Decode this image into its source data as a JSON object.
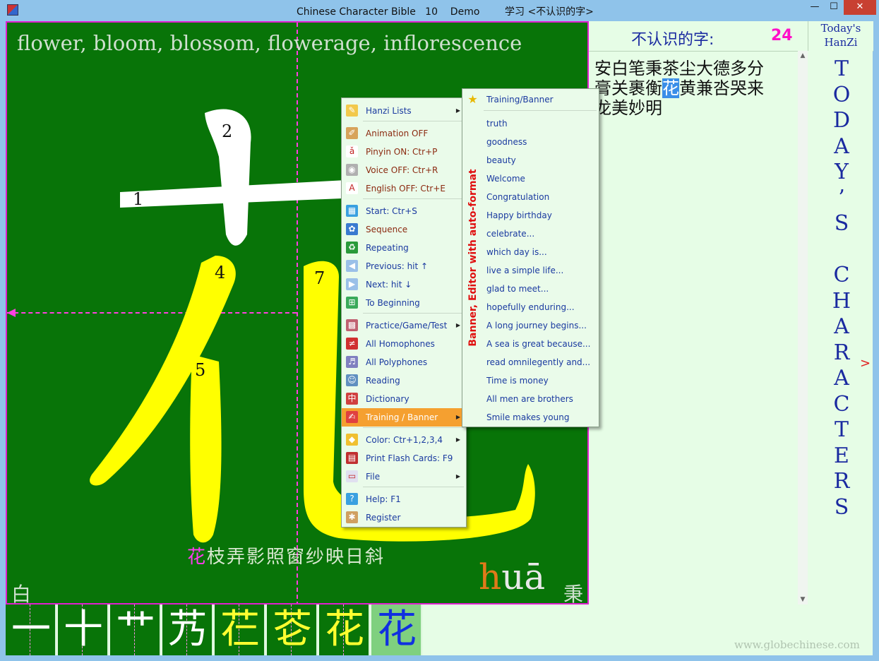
{
  "window": {
    "title": "Chinese Character Bible   10    Demo        学习 <不认识的字>",
    "minimize": "—",
    "maximize": "☐",
    "close": "✕"
  },
  "stage": {
    "meaning": "flower, bloom, blossom, flowerage, inflorescence",
    "stroke_numbers": [
      "1",
      "2",
      "4",
      "5",
      "7"
    ],
    "poem_highlight": "花",
    "poem_rest": "枝弄影照窗纱映日斜",
    "pinyin_initial": "h",
    "pinyin_final": "uā",
    "prev_char": "白",
    "next_char": "秉"
  },
  "right_panel": {
    "unknown_label": "不认识的字:",
    "unknown_count": "24",
    "today_head_line1": "Today's",
    "today_head_line2": "HanZi",
    "char_rows": [
      {
        "before": "安白笔秉茶尘大德多分",
        "selected": "",
        "after": ""
      },
      {
        "before": "膏关裹衡",
        "selected": "花",
        "after": "黄兼呇哭来"
      },
      {
        "before": "龙美妙明",
        "selected": "",
        "after": ""
      }
    ],
    "vertical_title": "TODAY'S CHARACTERS",
    "next_arrow": ">"
  },
  "stroke_tiles": [
    "一",
    "十",
    "艹",
    "艿",
    "芢",
    "芲",
    "花",
    "花"
  ],
  "website": "www.globechinese.com",
  "context_menu": {
    "items": [
      {
        "label": "Hanzi Lists",
        "icon": "hanzi-lists-icon",
        "glyph": "✎",
        "bg": "#f2c94c",
        "color": "blue",
        "sub": true
      },
      {
        "label": "Animation OFF",
        "icon": "animation-icon",
        "glyph": "✐",
        "bg": "#d7a35a",
        "color": "brown"
      },
      {
        "label": "Pinyin ON: Ctr+P",
        "icon": "pinyin-icon",
        "glyph": "ǎ",
        "bg": "#ffffff",
        "color": "brown"
      },
      {
        "label": "Voice OFF: Ctr+R",
        "icon": "voice-icon",
        "glyph": "◉",
        "bg": "#b0b0b0",
        "color": "brown"
      },
      {
        "label": "English OFF: Ctr+E",
        "icon": "english-icon",
        "glyph": "A",
        "bg": "#ffffff",
        "color": "brown"
      },
      {
        "label": "Start: Ctr+S",
        "icon": "start-icon",
        "glyph": "▦",
        "bg": "#3aa0e0",
        "color": "blue"
      },
      {
        "label": "Sequence",
        "icon": "sequence-icon",
        "glyph": "✿",
        "bg": "#3a7ad0",
        "color": "brown"
      },
      {
        "label": "Repeating",
        "icon": "repeating-icon",
        "glyph": "♻",
        "bg": "#2a9a3a",
        "color": "blue"
      },
      {
        "label": "Previous: hit ↑",
        "icon": "previous-icon",
        "glyph": "◀",
        "bg": "#9ac0e8",
        "color": "blue"
      },
      {
        "label": "Next: hit ↓",
        "icon": "next-icon",
        "glyph": "▶",
        "bg": "#9ac0e8",
        "color": "blue"
      },
      {
        "label": "To Beginning",
        "icon": "to-beginning-icon",
        "glyph": "⊞",
        "bg": "#3aaa5a",
        "color": "blue"
      },
      {
        "label": "Practice/Game/Test",
        "icon": "practice-icon",
        "glyph": "▩",
        "bg": "#c06070",
        "color": "blue",
        "sub": true
      },
      {
        "label": "All Homophones",
        "icon": "homophones-icon",
        "glyph": "≠",
        "bg": "#d03030",
        "color": "blue"
      },
      {
        "label": "All Polyphones",
        "icon": "polyphones-icon",
        "glyph": "♬",
        "bg": "#8080c0",
        "color": "blue"
      },
      {
        "label": "Reading",
        "icon": "reading-icon",
        "glyph": "☺",
        "bg": "#6090c0",
        "color": "blue"
      },
      {
        "label": "Dictionary",
        "icon": "dictionary-icon",
        "glyph": "中",
        "bg": "#d04040",
        "color": "blue"
      },
      {
        "label": "Training / Banner",
        "icon": "training-banner-icon",
        "glyph": "✍",
        "bg": "#e04040",
        "color": "hot",
        "sub": true
      },
      {
        "label": "Color: Ctr+1,2,3,4",
        "icon": "color-icon",
        "glyph": "◆",
        "bg": "#f0c030",
        "color": "blue",
        "sub": true
      },
      {
        "label": "Print Flash Cards: F9",
        "icon": "print-cards-icon",
        "glyph": "▤",
        "bg": "#c03030",
        "color": "blue"
      },
      {
        "label": "File",
        "icon": "file-icon",
        "glyph": "▭",
        "bg": "#e0e0f0",
        "color": "blue",
        "sub": true
      },
      {
        "label": "Help: F1",
        "icon": "help-icon",
        "glyph": "?",
        "bg": "#3aa0e0",
        "color": "blue"
      },
      {
        "label": "Register",
        "icon": "register-icon",
        "glyph": "✱",
        "bg": "#d0a060",
        "color": "blue"
      }
    ]
  },
  "submenu": {
    "header": "Training/Banner",
    "side_label": "Banner, Editor with auto-format",
    "items": [
      "truth",
      "goodness",
      "beauty",
      "Welcome",
      "Congratulation",
      "Happy birthday",
      "celebrate...",
      "which day is...",
      "live a simple life...",
      "glad to meet...",
      "hopefully enduring...",
      "A long journey begins...",
      "A sea is great because...",
      "read omnilegently and...",
      "Time is money",
      "All men are brothers",
      "Smile makes young"
    ]
  },
  "colors": {
    "stage_bg": "#087408",
    "accent_pink": "#ff40e0",
    "stroke_white": "#ffffff",
    "stroke_yellow": "#ffff00"
  }
}
